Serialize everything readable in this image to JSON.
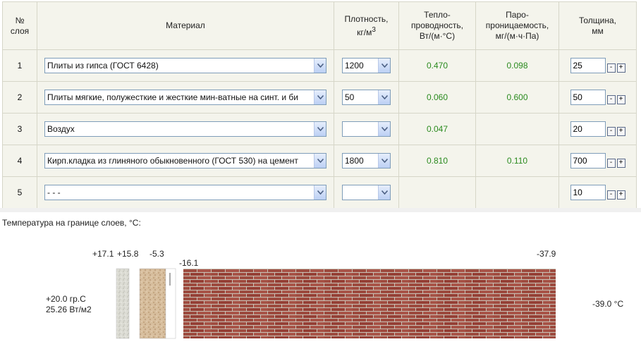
{
  "table": {
    "headers": {
      "num": [
        "№",
        "слоя"
      ],
      "material": "Материал",
      "density": [
        "Плотность,",
        "кг/м",
        "3"
      ],
      "thermal": [
        "Тепло-",
        "проводность,",
        "Вт/(м·°С)"
      ],
      "vapor": [
        "Паро-",
        "проницаемость,",
        "мг/(м·ч·Па)"
      ],
      "thickness": [
        "Толщина,",
        "мм"
      ]
    },
    "rows": [
      {
        "num": "1",
        "material": "Плиты из гипса (ГОСТ 6428)",
        "density": "1200",
        "thermal": "0.470",
        "vapor": "0.098",
        "thickness": "25"
      },
      {
        "num": "2",
        "material": "Плиты мягкие, полужесткие и жесткие мин-ватные на синт. и би",
        "density": "50",
        "thermal": "0.060",
        "vapor": "0.600",
        "thickness": "50"
      },
      {
        "num": "3",
        "material": "Воздух",
        "density": "",
        "thermal": "0.047",
        "vapor": "",
        "thickness": "20"
      },
      {
        "num": "4",
        "material": "Кирп.кладка из глиняного обыкновенного (ГОСТ 530) на цемент",
        "density": "1800",
        "thermal": "0.810",
        "vapor": "0.110",
        "thickness": "700"
      },
      {
        "num": "5",
        "material": "- - -",
        "density": "",
        "thermal": "",
        "vapor": "",
        "thickness": "10"
      }
    ],
    "minus": "-",
    "plus": "+"
  },
  "temperatures": {
    "title": "Температура на границе слоев, °С:",
    "b1": "+17.1",
    "b2": "+15.8",
    "b3": "-5.3",
    "b4": "-16.1",
    "b5": "-37.9",
    "inside_temp": "+20.0 гр.С",
    "heat_flux": "25.26 Вт/м2",
    "outside_temp": "-39.0 °С"
  },
  "colors": {
    "value_green": "#2a8a1e",
    "brick": "#9c4a3e",
    "mortar": "#c9c2b6"
  }
}
